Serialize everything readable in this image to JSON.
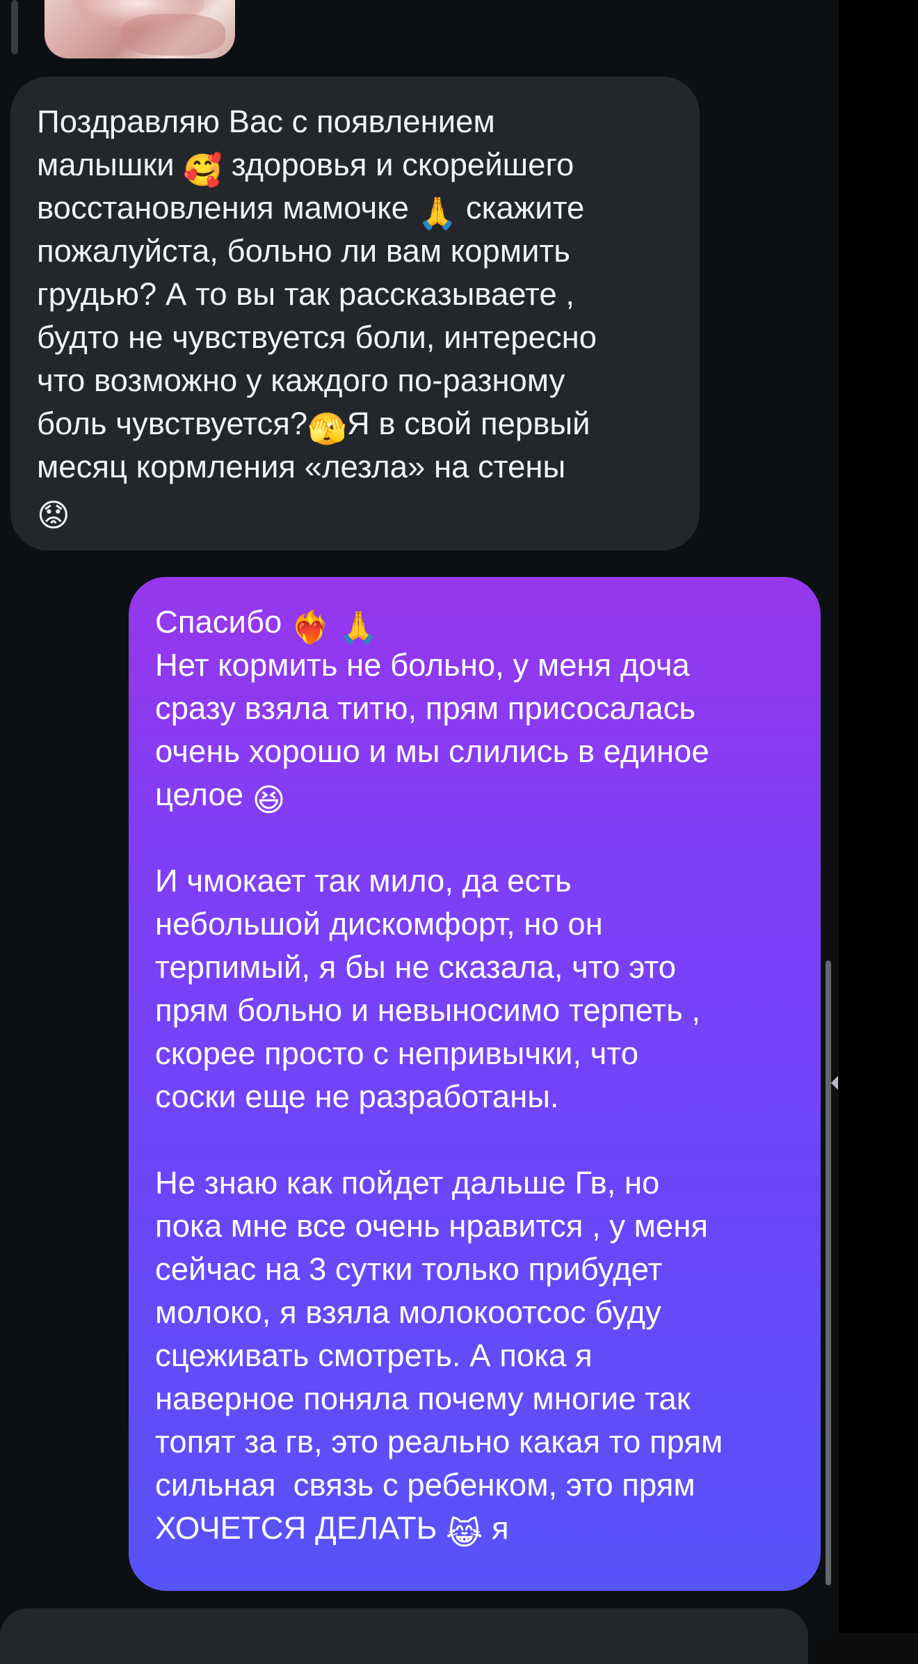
{
  "incoming_message": {
    "line_1": "Поздравляю Вас с появлением",
    "line_2a": "малышки ",
    "emoji_1": "🥰",
    "line_2b": " здоровья и скорейшего",
    "line_3a": "восстановления мамочке ",
    "emoji_2": "🙏",
    "line_3b": " скажите",
    "line_4": "пожалуйста, больно ли вам кормить",
    "line_5": "грудью? А то вы так рассказываете ,",
    "line_6": "будто не чувствуется боли, интересно",
    "line_7": "что возможно у каждого по-разному",
    "line_8a": "боль чувствуется?",
    "emoji_3": "🫣",
    "line_8b": "Я в свой первый",
    "line_9": "месяц кормления «лезла» на стены",
    "emoji_4": "😟"
  },
  "outgoing_message": {
    "line_1a": "Спасибо ",
    "emoji_1": "❤️‍🔥",
    "emoji_2": "🙏",
    "line_2": "Нет кормить не больно, у меня доча",
    "line_3": "сразу взяла титю, прям присосалась",
    "line_4": "очень хорошо и мы слились в единое",
    "line_5a": "целое ",
    "emoji_3": "😆",
    "p2_line_1": "И чмокает так мило, да есть",
    "p2_line_2": "небольшой дискомфорт, но он",
    "p2_line_3": "терпимый, я бы не сказала, что это",
    "p2_line_4": "прям больно и невыносимо терпеть ,",
    "p2_line_5": "скорее просто с непривычки, что",
    "p2_line_6": "соски еще не разработаны.",
    "p3_line_1": "Не знаю как пойдет дальше Гв, но",
    "p3_line_2": "пока мне все очень нравится , у меня",
    "p3_line_3": "сейчас на 3 сутки только прибудет",
    "p3_line_4": "молоко, я взяла молокоотсос буду",
    "p3_line_5": "сцеживать смотреть. А пока я",
    "p3_line_6": "наверное поняла почему многие так",
    "p3_line_7": "топят за гв, это реально какая то прям",
    "p3_line_8": "сильная  связь с ребенком, это прям",
    "p3_line_9a": "ХОЧЕТСЯ ДЕЛАТЬ ",
    "emoji_4": "😹",
    "p3_line_9b": " я"
  },
  "colors": {
    "background": "#0d1013",
    "incoming_bubble": "#23272b",
    "outgoing_gradient_top": "#9637ec",
    "outgoing_gradient_bottom": "#5653f7"
  }
}
